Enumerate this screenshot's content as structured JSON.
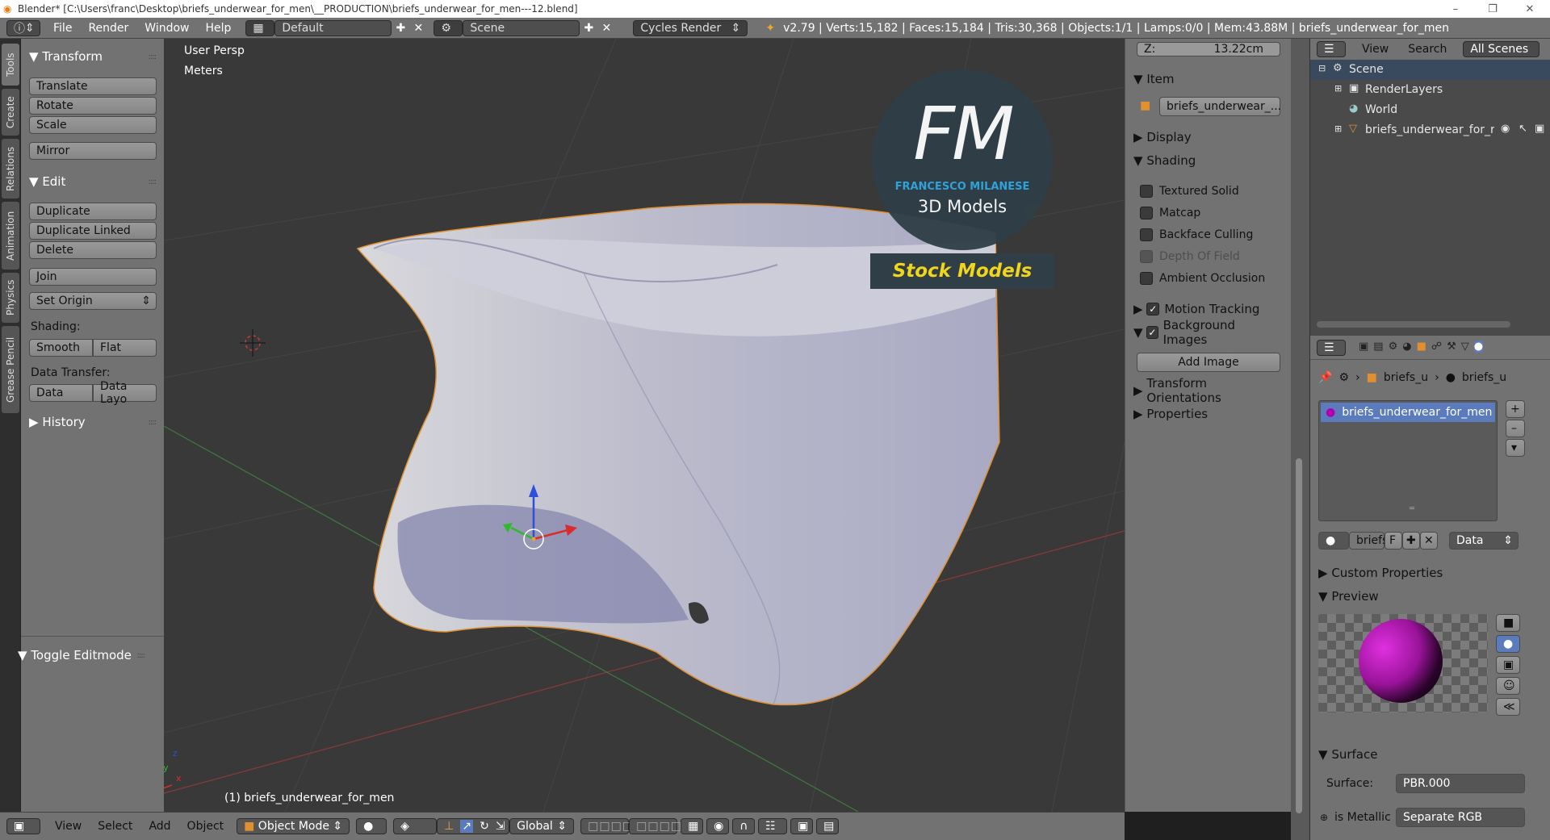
{
  "window": {
    "title": "Blender* [C:\\Users\\franc\\Desktop\\briefs_underwear_for_men\\__PRODUCTION\\briefs_underwear_for_men---12.blend]"
  },
  "info_header": {
    "menus": [
      "File",
      "Render",
      "Window",
      "Help"
    ],
    "layout": "Default",
    "scene": "Scene",
    "engine": "Cycles Render",
    "stats": "v2.79 | Verts:15,182 | Faces:15,184 | Tris:30,368 | Objects:1/1 | Lamps:0/0 | Mem:43.88M | briefs_underwear_for_men"
  },
  "tool_tabs": [
    "Tools",
    "Create",
    "Relations",
    "Animation",
    "Physics",
    "Grease Pencil"
  ],
  "tool_shelf": {
    "transform_title": "Transform",
    "translate": "Translate",
    "rotate": "Rotate",
    "scale": "Scale",
    "mirror": "Mirror",
    "edit_title": "Edit",
    "duplicate": "Duplicate",
    "duplicate_linked": "Duplicate Linked",
    "delete": "Delete",
    "join": "Join",
    "set_origin": "Set Origin",
    "shading_label": "Shading:",
    "smooth": "Smooth",
    "flat": "Flat",
    "data_transfer_label": "Data Transfer:",
    "data": "Data",
    "data_layout": "Data Layo",
    "history": "History",
    "toggle_editmode": "Toggle Editmode"
  },
  "viewport": {
    "view_name": "User Persp",
    "units": "Meters",
    "object_label": "(1) briefs_underwear_for_men",
    "watermark_top": "FM",
    "watermark_name": "FRANCESCO MILANESE",
    "watermark_sub": "3D Models",
    "watermark_banner": "Stock Models"
  },
  "n_panel": {
    "z_field": "Z:",
    "z_value": "13.22cm",
    "item_title": "Item",
    "item_name": "briefs_underwear_...",
    "display_title": "Display",
    "shading_title": "Shading",
    "textured_solid": "Textured Solid",
    "matcap": "Matcap",
    "backface_culling": "Backface Culling",
    "depth_of_field": "Depth Of Field",
    "ambient_occlusion": "Ambient Occlusion",
    "motion_tracking": "Motion Tracking",
    "background_images": "Background Images",
    "add_image": "Add Image",
    "transform_orientations": "Transform Orientations",
    "properties": "Properties"
  },
  "outliner": {
    "view": "View",
    "search": "Search",
    "filter": "All Scenes",
    "items": [
      "Scene",
      "RenderLayers",
      "World",
      "briefs_underwear_for_r"
    ]
  },
  "properties_editor": {
    "breadcrumb_1": "briefs_u",
    "breadcrumb_2": "briefs_u",
    "material_slot": "briefs_underwear_for_men",
    "material_name": "briefs",
    "fake_user": "F",
    "link_mode": "Data",
    "custom_properties": "Custom Properties",
    "preview": "Preview",
    "surface_title": "Surface",
    "surface_label": "Surface:",
    "surface_value": "PBR.000",
    "is_metallic_label": "is Metallic",
    "is_metallic_value": "Separate RGB"
  },
  "bottom_header": {
    "view": "View",
    "select": "Select",
    "add": "Add",
    "object": "Object",
    "mode": "Object Mode",
    "orientation": "Global"
  }
}
